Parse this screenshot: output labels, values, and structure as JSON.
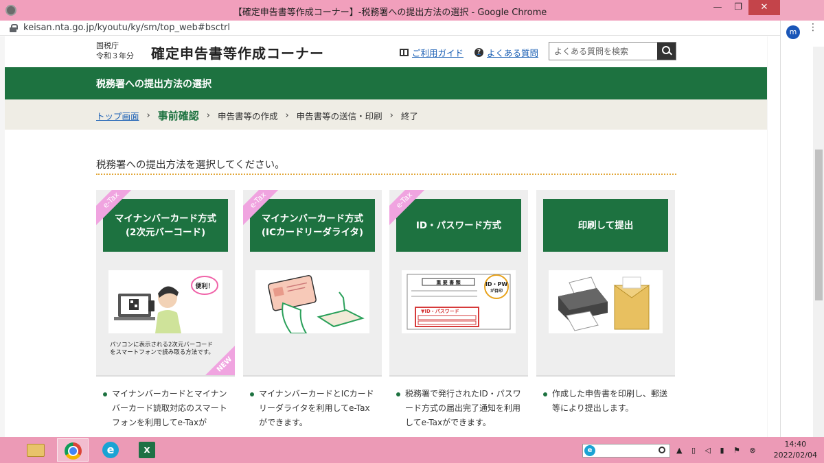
{
  "window": {
    "title": "【確定申告書等作成コーナー】-税務署への提出方法の選択 - Google Chrome",
    "url": "keisan.nta.go.jp/kyoutu/ky/sm/top_web#bsctrl",
    "minimize": "—",
    "maximize": "❐",
    "close": "✕"
  },
  "header": {
    "org_line1": "国税庁",
    "org_line2": "令和３年分",
    "site_title": "確定申告書等作成コーナー",
    "guide_link": "ご利用ガイド",
    "faq_link": "よくある質問",
    "faq_icon_glyph": "?",
    "search_placeholder": "よくある質問を検索"
  },
  "page_banner": "税務署への提出方法の選択",
  "breadcrumb": {
    "items": [
      "トップ画面",
      "事前確認",
      "申告書等の作成",
      "申告書等の送信・印刷",
      "終了"
    ],
    "separator": "›",
    "current_index": 1
  },
  "lead_text": "税務署への提出方法を選択してください。",
  "cards": [
    {
      "badge": "e-Tax",
      "title_line1": "マイナンバーカード方式",
      "title_line2": "(2次元バーコード)",
      "image_label": "便利！",
      "caption_line1": "パソコンに表示される2次元バーコード",
      "caption_line2": "をスマートフォンで読み取る方法です。",
      "new_badge": "NEW",
      "description": "マイナンバーカードとマイナンバーカード読取対応のスマートフォンを利用してe-Taxが"
    },
    {
      "badge": "e-Tax",
      "title_line1": "マイナンバーカード方式",
      "title_line2": "(ICカードリーダライタ)",
      "description": "マイナンバーカードとICカードリーダライタを利用してe-Taxができます。"
    },
    {
      "badge": "e-Tax",
      "title_line1": "ID・パスワード方式",
      "title_line2": "",
      "image_doc_title": "重 要 書 類",
      "image_badge_line1": "ID・PW",
      "image_badge_line2": "が目印",
      "image_label": "▼ID・パスワード",
      "description": "税務署で発行されたID・パスワード方式の届出完了通知を利用してe-Taxができます。"
    },
    {
      "badge": "",
      "title_line1": "印刷して提出",
      "title_line2": "",
      "description": "作成した申告書を印刷し、郵送等により提出します。"
    }
  ],
  "taskbar": {
    "search_icon_letter": "e",
    "tray_icons": "▲ ▯ ◁ ▮ ⚑ ⊗",
    "time": "14:40",
    "date": "2022/02/04"
  },
  "sidebar": {
    "avatar_letter": "m",
    "menu": "⋮"
  },
  "colors": {
    "brand_green": "#1d7240",
    "etax_pink": "#f0a4e0",
    "link_blue": "#1a5fb4",
    "accent_orange": "#e2a83a"
  }
}
